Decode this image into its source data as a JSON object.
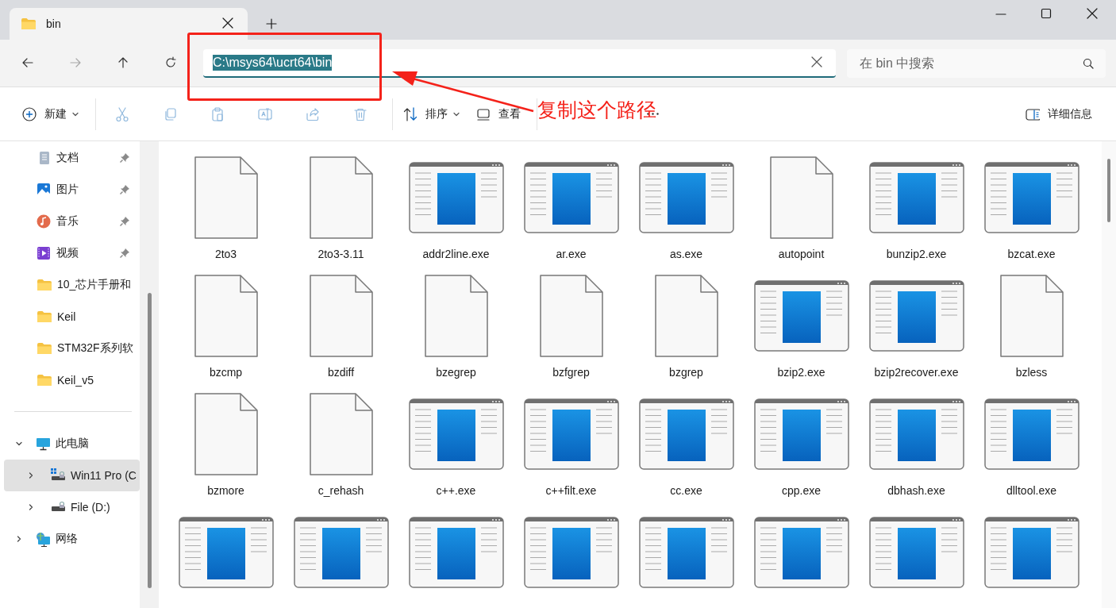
{
  "window": {
    "tab_title": "bin",
    "controls": [
      {
        "kind": "minimize"
      },
      {
        "kind": "maximize"
      },
      {
        "kind": "close"
      }
    ]
  },
  "navigation": [
    {
      "kind": "back",
      "disabled": false
    },
    {
      "kind": "forward",
      "disabled": true
    },
    {
      "kind": "up",
      "disabled": false
    },
    {
      "kind": "refresh",
      "disabled": false
    }
  ],
  "address": {
    "value": "C:\\msys64\\ucrt64\\bin",
    "selected": true
  },
  "search": {
    "placeholder": "在 bin 中搜索"
  },
  "toolbar": [
    {
      "kind": "new",
      "label": "新建",
      "dropdown": true,
      "disabled": false
    },
    {
      "kind": "divider"
    },
    {
      "kind": "cut",
      "disabled": true
    },
    {
      "kind": "copy",
      "disabled": true
    },
    {
      "kind": "paste",
      "disabled": true
    },
    {
      "kind": "rename",
      "disabled": true
    },
    {
      "kind": "share",
      "disabled": true
    },
    {
      "kind": "delete",
      "disabled": true
    },
    {
      "kind": "divider"
    },
    {
      "kind": "sort",
      "label": "排序",
      "dropdown": true,
      "disabled": false
    },
    {
      "kind": "view",
      "label": "查看",
      "dropdown": false,
      "disabled": false
    },
    {
      "kind": "divider"
    },
    {
      "kind": "more",
      "disabled": false
    },
    {
      "kind": "spacer"
    },
    {
      "kind": "details",
      "label": "详细信息",
      "disabled": false
    }
  ],
  "sidebar": {
    "quick_access": [
      {
        "label": "文档",
        "kind": "documents",
        "pinned": true
      },
      {
        "label": "图片",
        "kind": "pictures",
        "pinned": true
      },
      {
        "label": "音乐",
        "kind": "music",
        "pinned": true
      },
      {
        "label": "视频",
        "kind": "videos",
        "pinned": true
      },
      {
        "label": "10_芯片手册和",
        "kind": "folder",
        "pinned": false
      },
      {
        "label": "Keil",
        "kind": "folder",
        "pinned": false
      },
      {
        "label": "STM32F系列软",
        "kind": "folder",
        "pinned": false
      },
      {
        "label": "Keil_v5",
        "kind": "folder",
        "pinned": false
      }
    ],
    "tree": [
      {
        "label": "此电脑",
        "kind": "pc",
        "expanded": true,
        "selected": false,
        "children": [
          {
            "label": "Win11 Pro (C",
            "kind": "system-drive",
            "expanded": false,
            "selected": true
          },
          {
            "label": "File (D:)",
            "kind": "drive",
            "expanded": false,
            "selected": false
          }
        ]
      },
      {
        "label": "网络",
        "kind": "network",
        "expanded": false,
        "selected": false
      }
    ]
  },
  "files": [
    {
      "name": "2to3",
      "kind": "file"
    },
    {
      "name": "2to3-3.11",
      "kind": "file"
    },
    {
      "name": "addr2line.exe",
      "kind": "exe"
    },
    {
      "name": "ar.exe",
      "kind": "exe"
    },
    {
      "name": "as.exe",
      "kind": "exe"
    },
    {
      "name": "autopoint",
      "kind": "file"
    },
    {
      "name": "bunzip2.exe",
      "kind": "exe"
    },
    {
      "name": "bzcat.exe",
      "kind": "exe"
    },
    {
      "name": "bzcmp",
      "kind": "file"
    },
    {
      "name": "bzdiff",
      "kind": "file"
    },
    {
      "name": "bzegrep",
      "kind": "file"
    },
    {
      "name": "bzfgrep",
      "kind": "file"
    },
    {
      "name": "bzgrep",
      "kind": "file"
    },
    {
      "name": "bzip2.exe",
      "kind": "exe"
    },
    {
      "name": "bzip2recover.exe",
      "kind": "exe"
    },
    {
      "name": "bzless",
      "kind": "file"
    },
    {
      "name": "bzmore",
      "kind": "file"
    },
    {
      "name": "c_rehash",
      "kind": "file"
    },
    {
      "name": "c++.exe",
      "kind": "exe"
    },
    {
      "name": "c++filt.exe",
      "kind": "exe"
    },
    {
      "name": "cc.exe",
      "kind": "exe"
    },
    {
      "name": "cpp.exe",
      "kind": "exe"
    },
    {
      "name": "dbhash.exe",
      "kind": "exe"
    },
    {
      "name": "dlltool.exe",
      "kind": "exe"
    },
    {
      "kind": "exe"
    },
    {
      "kind": "exe"
    },
    {
      "kind": "exe"
    },
    {
      "kind": "exe"
    },
    {
      "kind": "exe"
    },
    {
      "kind": "exe"
    },
    {
      "kind": "exe"
    },
    {
      "kind": "exe"
    }
  ],
  "annotation": {
    "text": "复制这个路径"
  }
}
